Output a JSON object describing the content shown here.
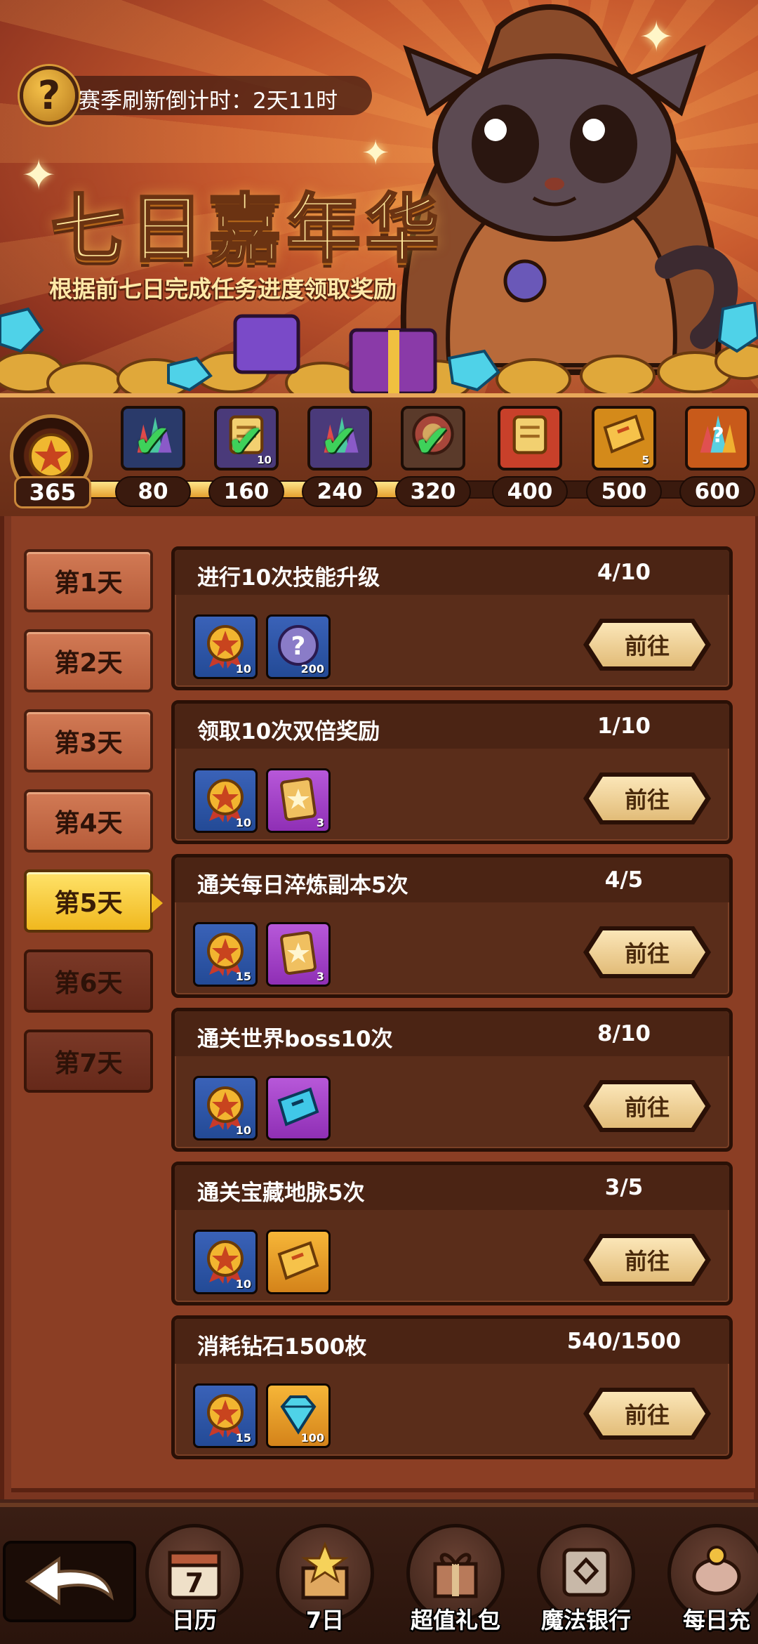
{
  "header": {
    "countdown": "赛季刷新倒计时：2天11时",
    "title": "七日嘉年华",
    "subtitle": "根据前七日完成任务进度领取奖励"
  },
  "progress": {
    "points": "365",
    "fraction": 0.6,
    "milestones": [
      {
        "label": "80",
        "icon": "gem-cluster-icon",
        "claimed": true,
        "qty": ""
      },
      {
        "label": "160",
        "icon": "scroll-icon",
        "claimed": true,
        "qty": "10"
      },
      {
        "label": "240",
        "icon": "gem-cluster-icon",
        "claimed": true,
        "qty": ""
      },
      {
        "label": "320",
        "icon": "medallion-icon",
        "claimed": true,
        "qty": ""
      },
      {
        "label": "400",
        "icon": "scroll-icon",
        "claimed": false,
        "qty": ""
      },
      {
        "label": "500",
        "icon": "ticket-icon",
        "claimed": false,
        "qty": "5"
      },
      {
        "label": "600",
        "icon": "mystery-crystal-icon",
        "claimed": false,
        "qty": ""
      }
    ]
  },
  "days": [
    {
      "label": "第1天",
      "state": "normal"
    },
    {
      "label": "第2天",
      "state": "normal"
    },
    {
      "label": "第3天",
      "state": "normal"
    },
    {
      "label": "第4天",
      "state": "normal"
    },
    {
      "label": "第5天",
      "state": "active"
    },
    {
      "label": "第6天",
      "state": "locked"
    },
    {
      "label": "第7天",
      "state": "locked"
    }
  ],
  "tasks": [
    {
      "title": "进行10次技能升级",
      "progress": "4/10",
      "button": "前往",
      "rewards": [
        {
          "icon": "star-medal-icon",
          "color": "blue",
          "qty": "10"
        },
        {
          "icon": "mystery-orb-icon",
          "color": "blue",
          "qty": "200"
        }
      ]
    },
    {
      "title": "领取10次双倍奖励",
      "progress": "1/10",
      "button": "前往",
      "rewards": [
        {
          "icon": "star-medal-icon",
          "color": "blue",
          "qty": "10"
        },
        {
          "icon": "star-card-icon",
          "color": "purple",
          "qty": "3"
        }
      ]
    },
    {
      "title": "通关每日淬炼副本5次",
      "progress": "4/5",
      "button": "前往",
      "rewards": [
        {
          "icon": "star-medal-icon",
          "color": "blue",
          "qty": "15"
        },
        {
          "icon": "star-card-icon",
          "color": "purple",
          "qty": "3"
        }
      ]
    },
    {
      "title": "通关世界boss10次",
      "progress": "8/10",
      "button": "前往",
      "rewards": [
        {
          "icon": "star-medal-icon",
          "color": "blue",
          "qty": "10"
        },
        {
          "icon": "blue-ticket-icon",
          "color": "purple",
          "qty": ""
        }
      ]
    },
    {
      "title": "通关宝藏地脉5次",
      "progress": "3/5",
      "button": "前往",
      "rewards": [
        {
          "icon": "star-medal-icon",
          "color": "blue",
          "qty": "10"
        },
        {
          "icon": "gold-ticket-icon",
          "color": "gold",
          "qty": ""
        }
      ]
    },
    {
      "title": "消耗钻石1500枚",
      "progress": "540/1500",
      "button": "前往",
      "rewards": [
        {
          "icon": "star-medal-icon",
          "color": "blue",
          "qty": "15"
        },
        {
          "icon": "diamond-icon",
          "color": "gold",
          "qty": "100"
        }
      ]
    }
  ],
  "nav": [
    {
      "label": "日历",
      "icon": "calendar-icon",
      "text": "7"
    },
    {
      "label": "7日",
      "icon": "star-box-icon",
      "text": ""
    },
    {
      "label": "超值礼包",
      "icon": "gift-icon",
      "text": ""
    },
    {
      "label": "魔法银行",
      "icon": "safe-icon",
      "text": ""
    },
    {
      "label": "每日充",
      "icon": "piggy-bank-icon",
      "text": ""
    }
  ],
  "colors": {
    "accent_gold": "#f0b81e",
    "check_green": "#3ed15a",
    "panel_brown": "#5a2d1a"
  }
}
